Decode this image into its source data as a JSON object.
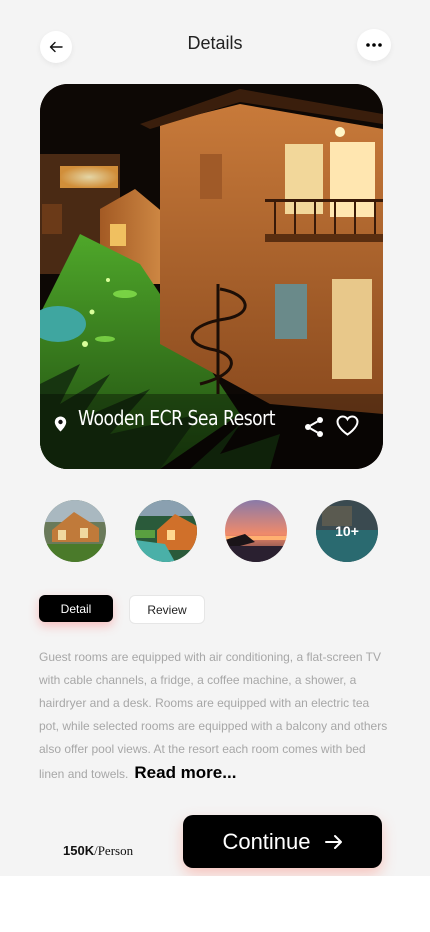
{
  "header": {
    "title": "Details",
    "back_icon": "arrow-left-icon",
    "more_icon": "more-horizontal-icon"
  },
  "hero": {
    "title": "Wooden ECR Sea Resort",
    "location_icon": "location-pin-icon",
    "share_icon": "share-icon",
    "favorite_icon": "heart-icon"
  },
  "gallery": {
    "more_label": "10+"
  },
  "tabs": [
    {
      "label": "Detail",
      "active": true
    },
    {
      "label": "Review",
      "active": false
    }
  ],
  "description": {
    "text": "Guest rooms are equipped with air conditioning, a flat-screen TV with cable channels, a fridge, a coffee machine, a shower, a hairdryer and a desk. Rooms are equipped with an electric tea pot, while selected rooms are equipped with a balcony and others also offer pool views. At the resort each room comes with bed linen and towels.",
    "read_more": "Read more..."
  },
  "footer": {
    "price": "150K",
    "price_unit": "/Person",
    "continue_label": "Continue",
    "continue_icon": "arrow-right-icon"
  },
  "colors": {
    "background": "#f4f4f4",
    "primary": "#000000",
    "accent_shadow": "#ff6e5a"
  }
}
